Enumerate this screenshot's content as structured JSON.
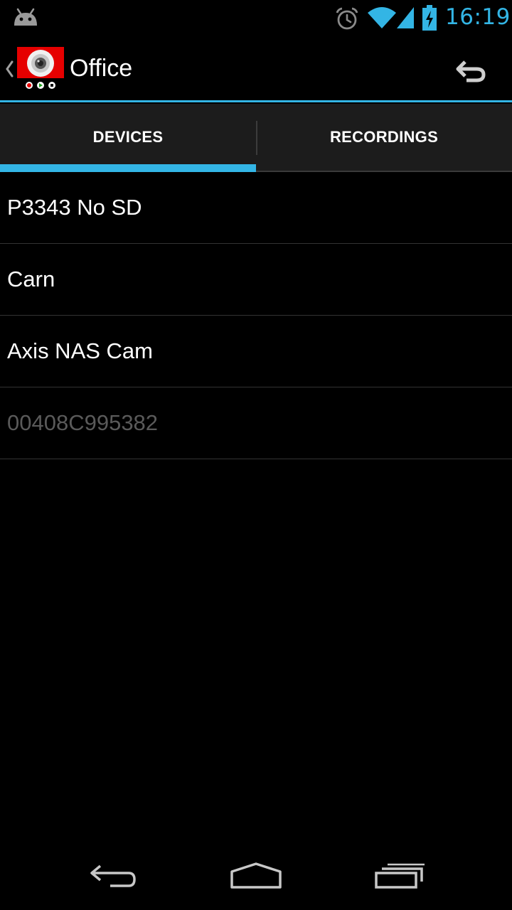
{
  "status_bar": {
    "time": "16:19",
    "icons": [
      "android-icon",
      "alarm-icon",
      "wifi-icon",
      "signal-icon",
      "battery-charging-icon"
    ],
    "accent_color": "#33b5e5"
  },
  "action_bar": {
    "title": "Office",
    "icons": [
      "up-caret-icon",
      "app-logo",
      "undo-icon"
    ]
  },
  "tabs": [
    {
      "label": "DEVICES",
      "selected": true
    },
    {
      "label": "RECORDINGS",
      "selected": false
    }
  ],
  "devices": [
    {
      "name": "P3343 No SD",
      "enabled": true
    },
    {
      "name": "Carn",
      "enabled": true
    },
    {
      "name": "Axis NAS Cam",
      "enabled": true
    },
    {
      "name": "00408C995382",
      "enabled": false
    }
  ],
  "nav_bar": {
    "icons": [
      "back-icon",
      "home-icon",
      "recent-apps-icon"
    ]
  },
  "colors": {
    "accent": "#33b5e5",
    "background": "#000000",
    "tab_background": "#1c1c1c",
    "disabled_text": "#5a5a5a"
  }
}
